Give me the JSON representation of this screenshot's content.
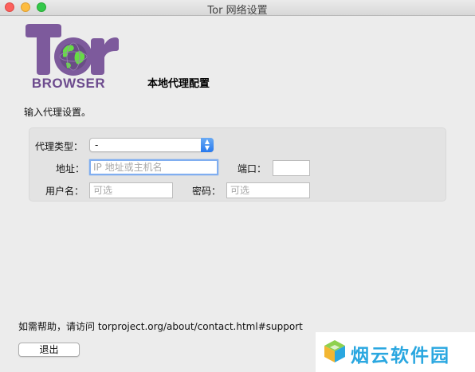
{
  "window": {
    "title": "Tor 网络设置"
  },
  "logo": {
    "text": "BROWSER"
  },
  "heading": "本地代理配置",
  "intro": "输入代理设置。",
  "proxy_form": {
    "type_label": "代理类型：",
    "type_value": "-",
    "address_label": "地址：",
    "address_placeholder": "IP 地址或主机名",
    "port_label": "端口：",
    "port_value": "",
    "username_label": "用户名：",
    "username_placeholder": "可选",
    "password_label": "密码：",
    "password_placeholder": "可选"
  },
  "help_text": "如需帮助，请访问 torproject.org/about/contact.html#support",
  "quit_button": "退出",
  "watermark": {
    "text": "烟云软件园"
  },
  "colors": {
    "tor_purple": "#7d5a9c",
    "globe_green": "#66dd44",
    "focus_ring": "#80aef0",
    "select_arrow": "#2779ee",
    "watermark_blue": "#2aa7e0"
  }
}
